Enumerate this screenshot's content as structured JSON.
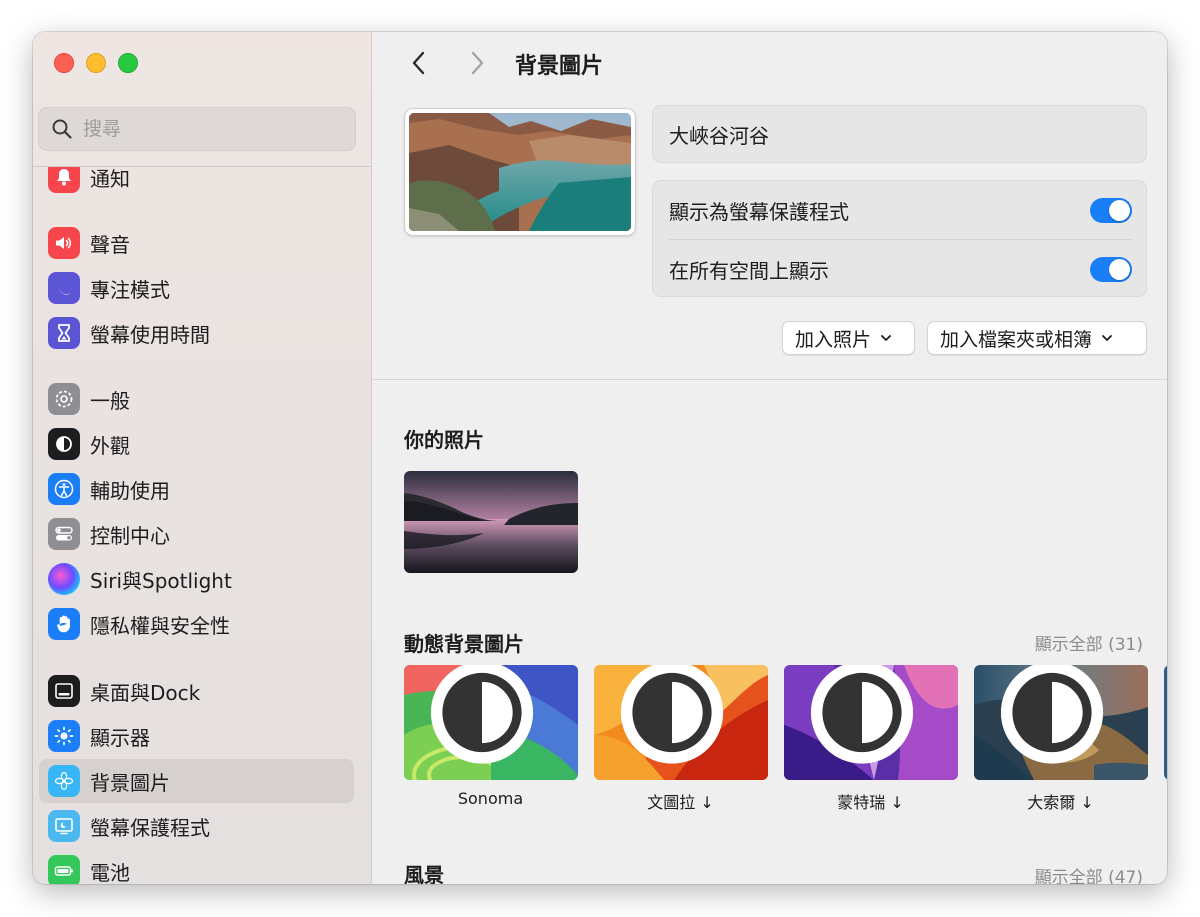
{
  "sidebar": {
    "search_placeholder": "搜尋",
    "items": [
      {
        "label": "通知",
        "icon": "bell-icon",
        "color": "#f6464b"
      },
      {
        "label": "聲音",
        "icon": "speaker-icon",
        "color": "#f6464b"
      },
      {
        "label": "專注模式",
        "icon": "moon-icon",
        "color": "#5b55d6"
      },
      {
        "label": "螢幕使用時間",
        "icon": "hourglass-icon",
        "color": "#5b55d6"
      },
      {
        "label": "一般",
        "icon": "gear-icon",
        "color": "#8e8e93"
      },
      {
        "label": "外觀",
        "icon": "appearance-icon",
        "color": "#1d1d1f"
      },
      {
        "label": "輔助使用",
        "icon": "accessibility-icon",
        "color": "#1a7ef6"
      },
      {
        "label": "控制中心",
        "icon": "control-center-icon",
        "color": "#8e8e93"
      },
      {
        "label": "Siri與Spotlight",
        "icon": "siri-icon",
        "color": "#3b3bb0"
      },
      {
        "label": "隱私權與安全性",
        "icon": "hand-icon",
        "color": "#1a7ef6"
      },
      {
        "label": "桌面與Dock",
        "icon": "dock-icon",
        "color": "#1d1d1f"
      },
      {
        "label": "顯示器",
        "icon": "sun-icon",
        "color": "#1a7ef6"
      },
      {
        "label": "背景圖片",
        "icon": "flower-icon",
        "color": "#38b6f5"
      },
      {
        "label": "螢幕保護程式",
        "icon": "screensaver-icon",
        "color": "#4bb8ef"
      },
      {
        "label": "電池",
        "icon": "battery-icon",
        "color": "#34c759"
      }
    ],
    "selected": "背景圖片"
  },
  "header": {
    "title": "背景圖片",
    "back_icon": "chevron-left-icon",
    "forward_icon": "chevron-right-icon"
  },
  "current": {
    "name": "大峽谷河谷",
    "toggle_screensaver_label": "顯示為螢幕保護程式",
    "toggle_screensaver_on": true,
    "toggle_all_spaces_label": "在所有空間上顯示",
    "toggle_all_spaces_on": true,
    "add_photo_label": "加入照片",
    "add_folder_label": "加入檔案夾或相簿"
  },
  "sections": {
    "your_photos": {
      "title": "你的照片"
    },
    "dynamic": {
      "title": "動態背景圖片",
      "show_all": "顯示全部 (31)",
      "items": [
        {
          "label": "Sonoma"
        },
        {
          "label": "文圖拉 ↓"
        },
        {
          "label": "蒙特瑞 ↓"
        },
        {
          "label": "大索爾 ↓"
        }
      ]
    },
    "landscape": {
      "title": "風景",
      "show_all": "顯示全部 (47)"
    }
  }
}
